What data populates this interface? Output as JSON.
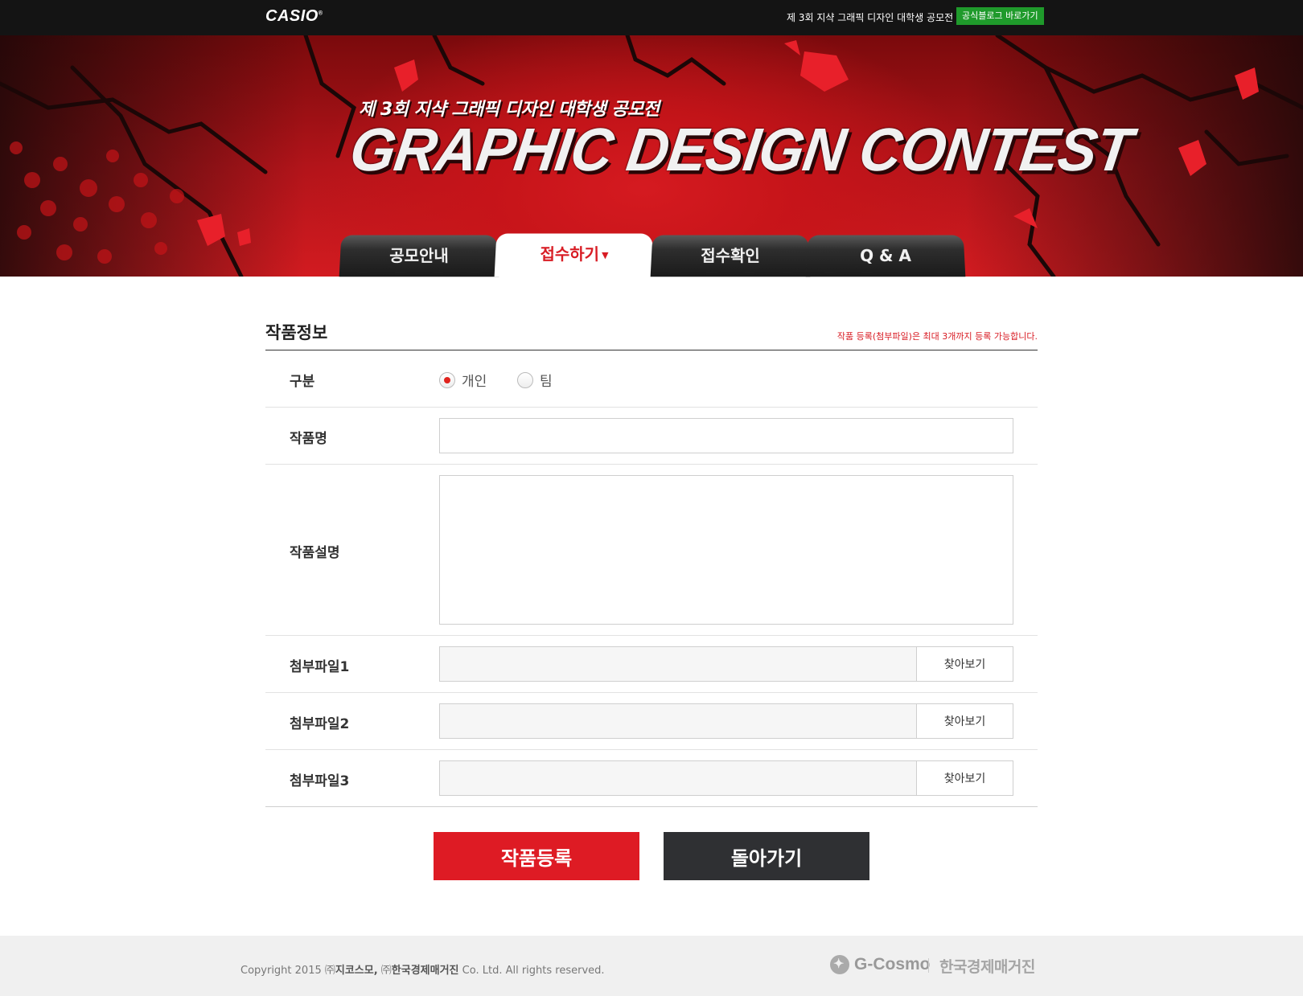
{
  "topbar": {
    "logo": "CASIO",
    "title": "제 3회 지샥 그래픽 디자인 대학생 공모전",
    "blog_button": "공식블로그 바로가기"
  },
  "banner": {
    "subtitle": "제 3회 지샥 그래픽 디자인 대학생 공모전",
    "title": "GRAPHIC DESIGN CONTEST"
  },
  "tabs": [
    {
      "label": "공모안내",
      "active": false
    },
    {
      "label": "접수하기",
      "active": true
    },
    {
      "label": "접수확인",
      "active": false
    },
    {
      "label": "Q & A",
      "active": false
    }
  ],
  "section": {
    "title": "작품정보",
    "note": "작품 등록(첨부파일)은 최대 3개까지 등록 가능합니다."
  },
  "form": {
    "category_label": "구분",
    "category_options": [
      {
        "label": "개인",
        "selected": true
      },
      {
        "label": "팀",
        "selected": false
      }
    ],
    "title_label": "작품명",
    "title_value": "",
    "description_label": "작품설명",
    "description_value": "",
    "files": [
      {
        "label": "첨부파일1",
        "button": "찾아보기"
      },
      {
        "label": "첨부파일2",
        "button": "찾아보기"
      },
      {
        "label": "첨부파일3",
        "button": "찾아보기"
      }
    ]
  },
  "actions": {
    "submit": "작품등록",
    "back": "돌아가기"
  },
  "footer": {
    "copyright_prefix": "Copyright 2015 ㈜",
    "company1": "지코스모,",
    "copyright_mid": " ㈜",
    "company2": "한국경제매거진",
    "copyright_suffix": " Co. Ltd. All rights reserved.",
    "logo1": "G-Cosmo",
    "logo2": "한국경제매거진"
  },
  "colors": {
    "accent_red": "#de1b24",
    "dark_button": "#2f3033",
    "blog_green": "#1f9a2b"
  }
}
